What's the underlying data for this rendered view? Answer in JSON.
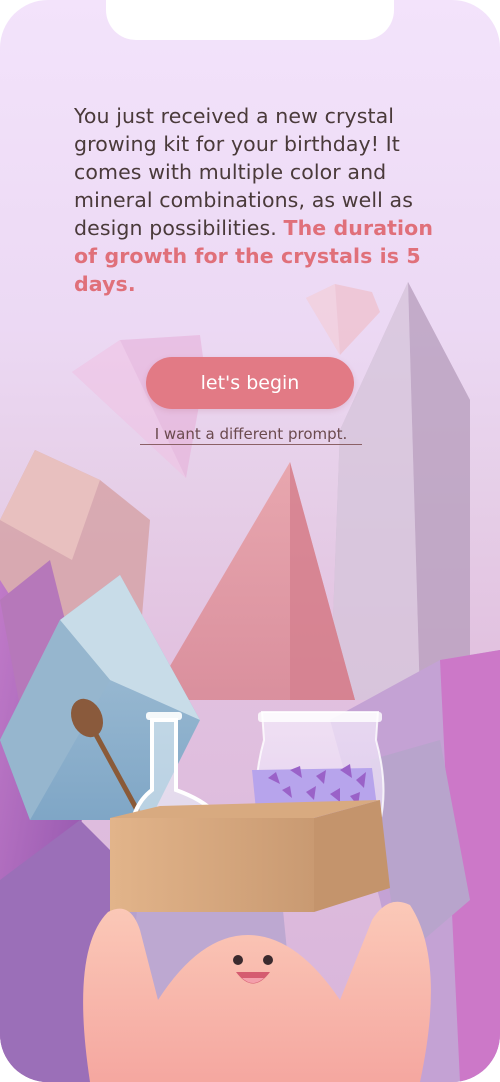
{
  "prompt": {
    "text": "You just received a new crystal growing kit for your birthday! It comes with multiple color and mineral combinations, as well as design possibilities. ",
    "highlight": "The duration of growth for the crystals is 5 days."
  },
  "actions": {
    "begin_label": "let's begin",
    "alt_prompt_label": "I want a different prompt."
  },
  "colors": {
    "accent": "#e27a85",
    "highlight_text": "#e0707a",
    "body_text": "#4a3a3a"
  }
}
